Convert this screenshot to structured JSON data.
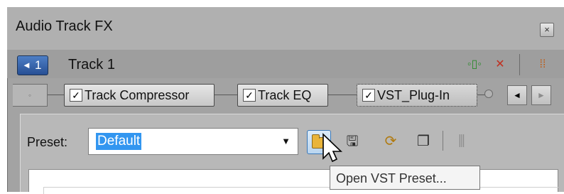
{
  "window": {
    "title": "Audio Track FX",
    "close_glyph": "×"
  },
  "track": {
    "speaker_glyph": "◄",
    "number": "1",
    "name": "Track 1"
  },
  "header_icons": [
    {
      "name": "plugin-chain-icon",
      "glyph": "◦▯◦"
    },
    {
      "name": "remove-plugin-icon",
      "glyph": "✕"
    },
    {
      "name": "mixer-icon",
      "glyph": "⁞⁞"
    }
  ],
  "chain": {
    "plugins": [
      {
        "label": "Track Compressor",
        "checked": true
      },
      {
        "label": "Track EQ",
        "checked": true
      },
      {
        "label": "VST_Plug-In",
        "checked": true,
        "selected": true
      }
    ],
    "check_glyph": "✓",
    "nav_prev": "◄",
    "nav_next": "►"
  },
  "preset": {
    "label": "Preset:",
    "value": "Default",
    "dropdown_glyph": "▼"
  },
  "toolbar": {
    "save_glyph": "🖫",
    "refresh_glyph": "⟳",
    "copy_glyph": "❐",
    "settings_glyph": "⫼"
  },
  "tooltip": {
    "text": "Open VST Preset..."
  },
  "colors": {
    "accent": "#3296f0",
    "track_badge": "#3a6bb5",
    "frame": "#a3a3a3"
  }
}
